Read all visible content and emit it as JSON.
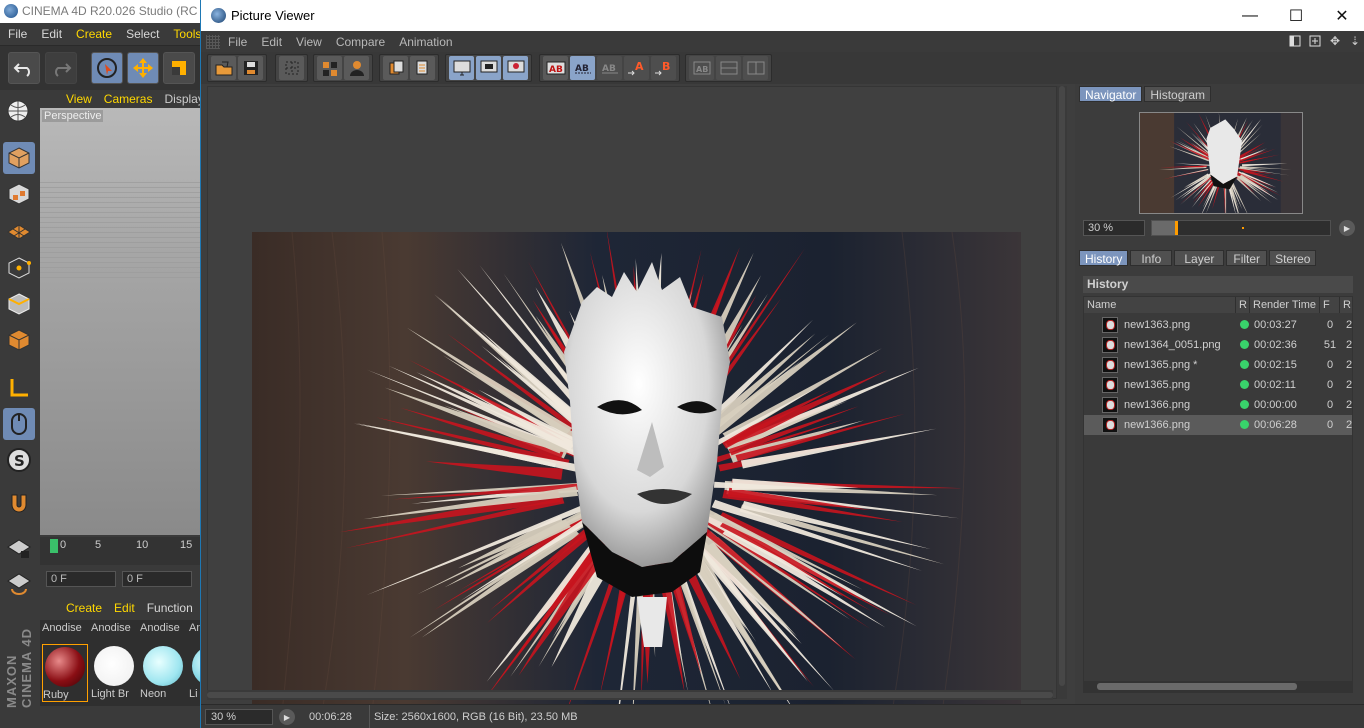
{
  "c4d": {
    "title": "CINEMA 4D R20.026 Studio (RC -",
    "menu": [
      "File",
      "Edit",
      "Create",
      "Select",
      "Tools"
    ],
    "viewport_menu": [
      "View",
      "Cameras",
      "Display"
    ],
    "viewport_label": "Perspective",
    "timeline_ticks": [
      "0",
      "5",
      "10",
      "15"
    ],
    "frame_start": "0 F",
    "frame_current": "0 F",
    "material_menu": [
      "Create",
      "Edit",
      "Function"
    ],
    "materials_top": [
      "Anodise",
      "Anodise",
      "Anodise",
      "An"
    ],
    "materials_bottom": [
      "Ruby",
      "Light Br",
      "Neon",
      "Li"
    ],
    "brand": "MAXON CINEMA 4D"
  },
  "picture_viewer": {
    "title": "Picture Viewer",
    "window_controls": {
      "minimize": "—",
      "maximize": "☐",
      "close": "✕"
    },
    "menu": [
      "File",
      "Edit",
      "View",
      "Compare",
      "Animation"
    ],
    "toolbar_letters": {
      "a": "A",
      "b": "B"
    },
    "navigator_tabs": [
      "Navigator",
      "Histogram"
    ],
    "navigator_zoom": "30 %",
    "navigator_position": 0.13,
    "info_tabs": [
      "History",
      "Info",
      "Layer",
      "Filter",
      "Stereo"
    ],
    "history_title": "History",
    "history_columns": [
      "Name",
      "R",
      "Render Time",
      "F",
      "R"
    ],
    "history": [
      {
        "name": "new1363.png",
        "render_time": "00:03:27",
        "frames": "0",
        "r2": "2"
      },
      {
        "name": "new1364_0051.png",
        "render_time": "00:02:36",
        "frames": "51",
        "r2": "2"
      },
      {
        "name": "new1365.png *",
        "render_time": "00:02:15",
        "frames": "0",
        "r2": "2"
      },
      {
        "name": "new1365.png",
        "render_time": "00:02:11",
        "frames": "0",
        "r2": "2"
      },
      {
        "name": "new1366.png",
        "render_time": "00:00:00",
        "frames": "0",
        "r2": "2"
      },
      {
        "name": "new1366.png",
        "render_time": "00:06:28",
        "frames": "0",
        "r2": "2"
      }
    ],
    "status": {
      "zoom": "30 %",
      "time": "00:06:28",
      "size": "Size: 2560x1600, RGB (16 Bit), 23.50 MB"
    },
    "colors": {
      "accent": "#7c95bd",
      "render_ok": "#39d36b",
      "slider_handle": "#ff9c00"
    }
  }
}
